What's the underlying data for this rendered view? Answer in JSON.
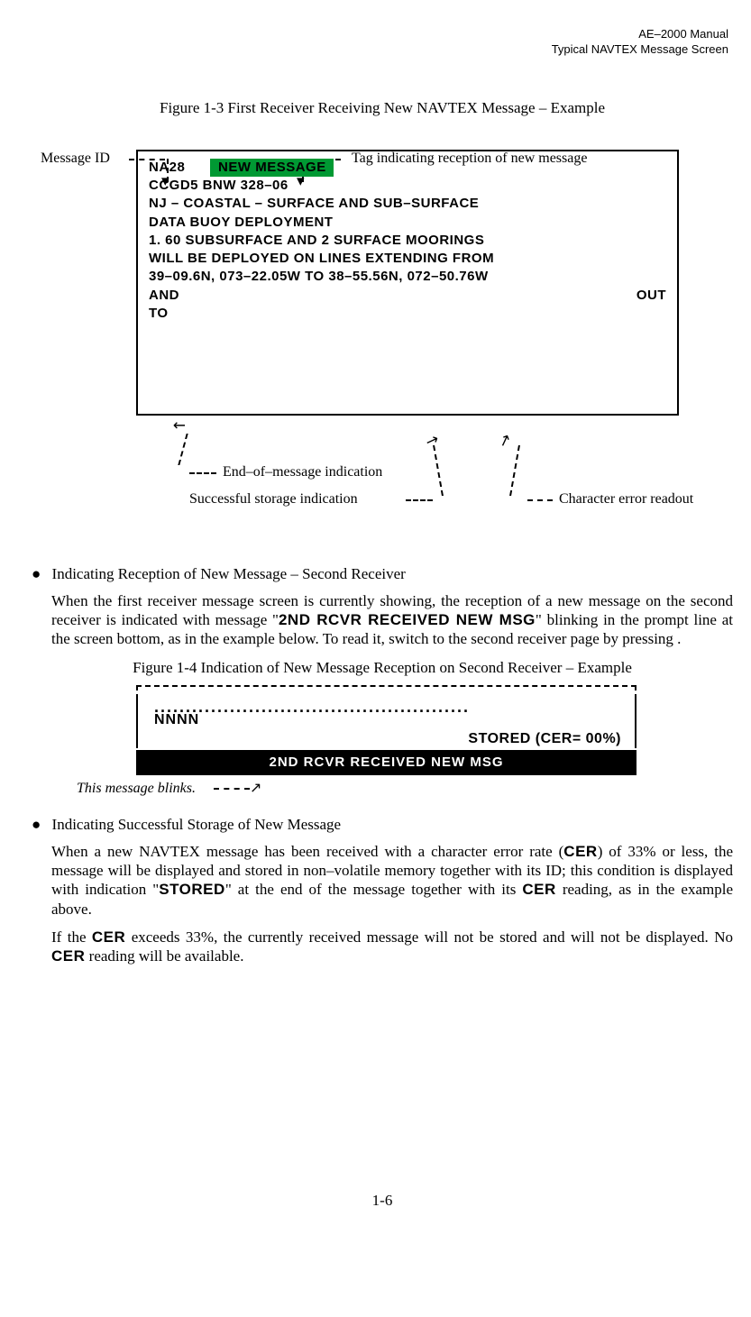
{
  "header": {
    "line1": "AE–2000 Manual",
    "line2": "Typical NAVTEX Message Screen"
  },
  "figure1": {
    "caption": "Figure 1-3   First Receiver Receiving New NAVTEX Message – Example",
    "annotations": {
      "message_id": "Message ID",
      "tag_reception": "Tag indicating reception of new message",
      "end_of_message": "End–of–message indication",
      "successful_storage": "Successful storage indication",
      "char_error": "Character error readout"
    },
    "msg": {
      "na28": "NA28",
      "new_message": "NEW MESSAGE",
      "line2": "CCGD5 BNW 328–06",
      "line3": "NJ – COASTAL – SURFACE AND SUB–SURFACE",
      "line4": "DATA BUOY DEPLOYMENT",
      "line5": "1. 60 SUBSURFACE AND 2 SURFACE MOORINGS",
      "line6": "WILL BE DEPLOYED ON LINES EXTENDING FROM",
      "line7": "39–09.6N, 073–22.05W TO 38–55.56N, 072–50.76W",
      "line8a": "AND",
      "line8b": "OUT",
      "line9": "TO"
    }
  },
  "section1": {
    "heading": "Indicating Reception of New Message – Second Receiver",
    "para_pre": "When the first receiver message screen is currently showing, the reception of a new message on the second receiver is indicated with message \"",
    "bold1": "2ND RCVR RECEIVED NEW MSG",
    "para_post": "\" blinking in the prompt line at the screen bottom, as in the example below. To read it, switch to the second receiver page by pressing       ."
  },
  "figure2": {
    "caption": "Figure 1-4   Indication of New Message Reception on Second Receiver – Example",
    "dots": "..................................................",
    "nnnn": "NNNN",
    "stored": "STORED (CER= 00%)",
    "blackbar": "2ND RCVR RECEIVED NEW MSG",
    "blinks_note": "This message blinks."
  },
  "section2": {
    "heading": "Indicating Successful Storage of New Message",
    "para1_a": "When a new NAVTEX message has been received with a character error rate (",
    "cer": "CER",
    "para1_b": ") of 33% or less, the message will be displayed and stored in non–volatile memory together with its ID; this condition is displayed with indication \"",
    "stored": "STORED",
    "para1_c": "\" at the end of the message together with its ",
    "para1_d": " reading, as in the example above.",
    "para2_a": "If the ",
    "para2_b": " exceeds 33%, the currently received message will not be stored and will not be displayed. No ",
    "para2_c": " reading will be available."
  },
  "page_number": "1-6"
}
